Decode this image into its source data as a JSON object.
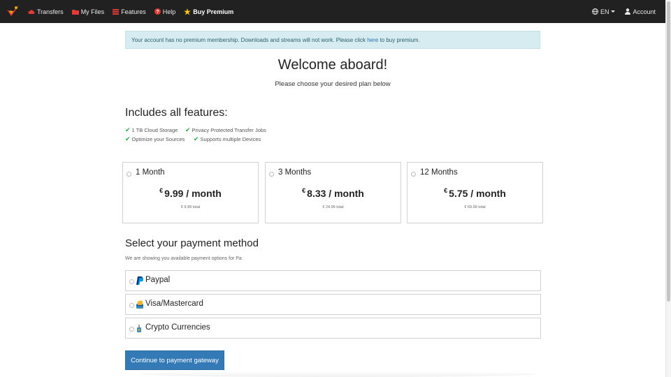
{
  "navbar": {
    "items": [
      {
        "label": "Transfers",
        "icon": "cloud-icon"
      },
      {
        "label": "My Files",
        "icon": "folder-icon"
      },
      {
        "label": "Features",
        "icon": "list-icon"
      },
      {
        "label": "Help",
        "icon": "help-icon"
      },
      {
        "label": "Buy Premium",
        "icon": "star-icon"
      }
    ],
    "language": "EN",
    "account": "Account"
  },
  "alert": {
    "text_before": "Your account has no premium membership. Downloads and streams will not work. Please click ",
    "link": "here",
    "text_after": " to buy premium."
  },
  "header": {
    "title": "Welcome aboard!",
    "subtitle": "Please choose your desired plan below"
  },
  "features": {
    "title": "Includes all features:",
    "items": [
      "1 TB Cloud Storage",
      "Privacy Protected Transfer Jobs",
      "Optimize your Sources",
      "Supports multiple Devices"
    ]
  },
  "plans": [
    {
      "name": "1 Month",
      "currency": "€",
      "price": "9.99 / month",
      "total": "€ 9.99 total"
    },
    {
      "name": "3 Months",
      "currency": "€",
      "price": "8.33 / month",
      "total": "€ 24.99 total"
    },
    {
      "name": "12 Months",
      "currency": "€",
      "price": "5.75 / month",
      "total": "€ 69.99 total"
    }
  ],
  "payment": {
    "title": "Select your payment method",
    "subtitle": "We are showing you available payment options for Pa",
    "options": [
      "Paypal",
      "Visa/Mastercard",
      "Crypto Currencies"
    ]
  },
  "continue_label": "Continue to payment gateway",
  "colors": {
    "navbar": "#212121",
    "accent": "#337ab7",
    "check": "#28a745",
    "alert_bg": "#d6ecf1",
    "brand": "#e53935"
  }
}
